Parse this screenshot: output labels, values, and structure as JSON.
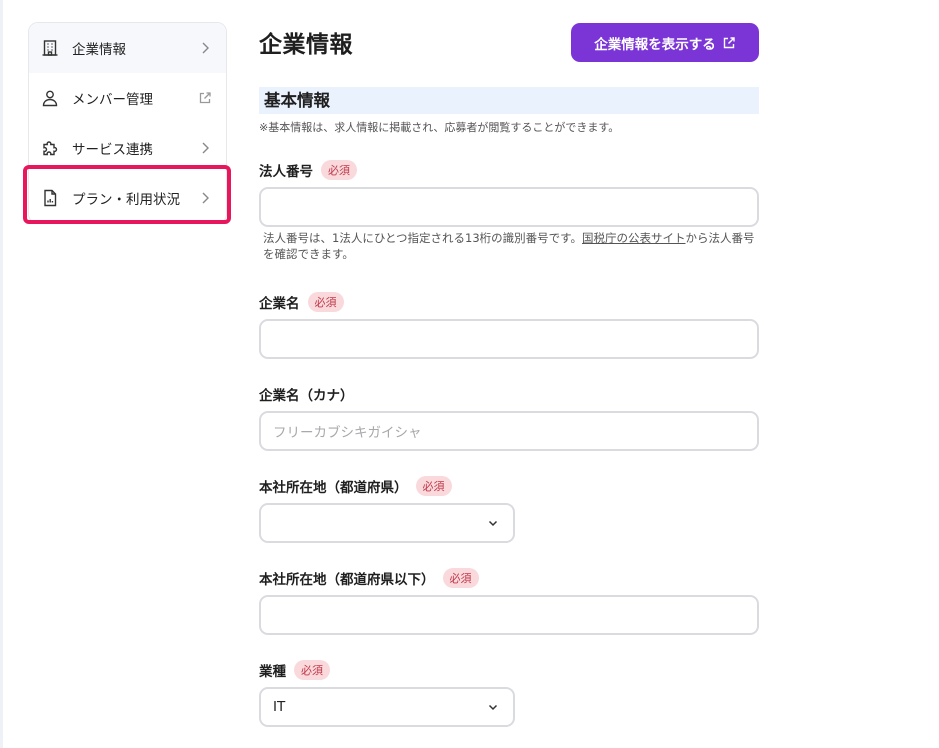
{
  "sidebar": {
    "items": [
      {
        "label": "企業情報",
        "icon": "building-icon",
        "trail": "chevron-right-icon"
      },
      {
        "label": "メンバー管理",
        "icon": "user-icon",
        "trail": "external-link-icon"
      },
      {
        "label": "サービス連携",
        "icon": "puzzle-icon",
        "trail": "chevron-right-icon"
      },
      {
        "label": "プラン・利用状況",
        "icon": "report-icon",
        "trail": "chevron-right-icon"
      }
    ],
    "highlight_color": "#e8175d"
  },
  "header": {
    "title": "企業情報",
    "view_button": "企業情報を表示する"
  },
  "section": {
    "title": "基本情報",
    "note": "※基本情報は、求人情報に掲載され、応募者が閲覧することができます。"
  },
  "form": {
    "required_label": "必須",
    "corporate_number": {
      "label": "法人番号",
      "value": "",
      "help_before": "法人番号は、1法人にひとつ指定される13桁の識別番号です。",
      "help_link": "国税庁の公表サイト",
      "help_after": "から法人番号を確認できます。"
    },
    "company_name": {
      "label": "企業名",
      "value": ""
    },
    "company_kana": {
      "label": "企業名（カナ）",
      "placeholder": "フリーカブシキガイシャ"
    },
    "hq_prefecture": {
      "label": "本社所在地（都道府県）",
      "value": ""
    },
    "hq_address": {
      "label": "本社所在地（都道府県以下）",
      "value": ""
    },
    "industry": {
      "label": "業種",
      "value": "IT"
    }
  },
  "colors": {
    "accent": "#7b35d6",
    "section_bg": "#eaf2fd",
    "badge_bg": "#f9d9dc",
    "badge_text": "#c0394b"
  }
}
